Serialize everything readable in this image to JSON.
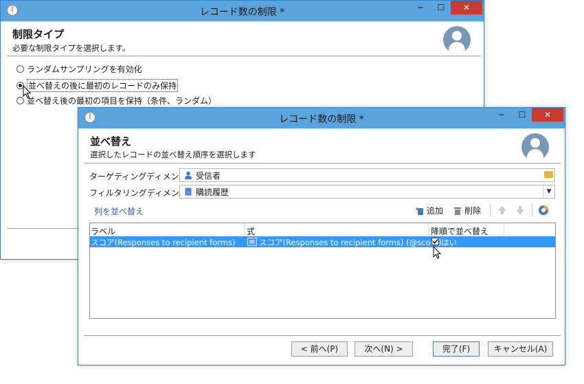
{
  "back_window": {
    "title": "レコード数の制限 *",
    "header_title": "制限タイプ",
    "header_subtitle": "必要な制限タイプを選択します。",
    "options": [
      {
        "label": "ランダムサンプリングを有効化",
        "selected": false
      },
      {
        "label": "並べ替えの後に最初のレコードのみ保持",
        "selected": true
      },
      {
        "label": "並べ替え後の最初の項目を保持（条件、ランダム）",
        "selected": false
      }
    ],
    "controls": {
      "minimize": "─",
      "maximize": "☐",
      "close": "✕"
    }
  },
  "front_window": {
    "title": "レコード数の制限 *",
    "header_title": "並べ替え",
    "header_subtitle": "選択したレコードの並べ替え順序を選択します",
    "targeting_label": "ターゲティングディメンション:",
    "targeting_value": "受信者",
    "filtering_label": "フィルタリングディメンション:",
    "filtering_value": "購読履歴",
    "sort_link": "列を並べ替え",
    "toolbar": {
      "add": "追加",
      "delete": "削除"
    },
    "grid": {
      "headers": [
        "ラベル",
        "式",
        "降順で並べ替え"
      ],
      "rows": [
        {
          "label": "スコア(Responses to recipient forms)",
          "expr": "スコア(Responses to recipient forms) (@score)",
          "desc": "はい"
        }
      ]
    },
    "buttons": {
      "prev": "< 前へ(P)",
      "next": "次へ(N) >",
      "finish": "完了(F)",
      "cancel": "キャンセル(A)"
    },
    "controls": {
      "minimize": "─",
      "maximize": "☐",
      "close": "✕"
    },
    "colors": {
      "accent": "#3399ff",
      "title_bar": "#5aa3dc",
      "close": "#c83b30"
    }
  }
}
